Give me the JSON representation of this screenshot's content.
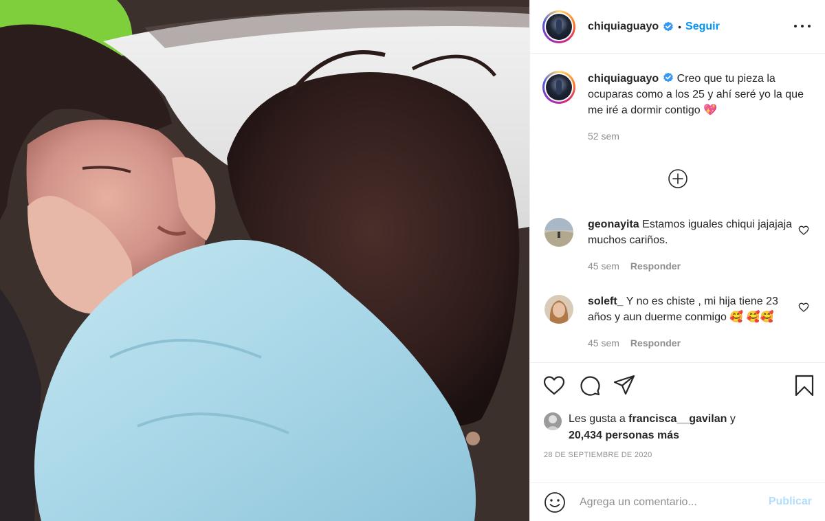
{
  "post": {
    "username": "chiquiaguayo",
    "follow_label": "Seguir",
    "dot": "•",
    "verified_icon": "verified-badge-icon",
    "more_icon": "more-options-icon"
  },
  "caption": {
    "username": "chiquiaguayo",
    "text": "Creo que tu pieza la ocuparas como a los 25 y ahí seré yo la que me iré a dormir contigo 💖",
    "time": "52 sem"
  },
  "load_more_icon": "plus-circle-icon",
  "comments": [
    {
      "username": "geonayita",
      "text": "Estamos iguales chiqui jajajaja muchos cariños.",
      "time": "45 sem",
      "reply_label": "Responder"
    },
    {
      "username": "soleft_",
      "text": "Y no es chiste , mi hija tiene 23 años y aun duerme conmigo 🥰 🥰🥰",
      "time": "45 sem",
      "reply_label": "Responder"
    }
  ],
  "actions": {
    "like_icon": "heart-icon",
    "comment_icon": "comment-icon",
    "share_icon": "paper-plane-icon",
    "save_icon": "bookmark-icon"
  },
  "likes": {
    "prefix": "Les gusta a ",
    "user": "francisca__gavilan",
    "suffix": " y",
    "count": "20,434 personas más"
  },
  "date": "28 DE SEPTIEMBRE DE 2020",
  "add_comment": {
    "placeholder": "Agrega un comentario...",
    "publish_label": "Publicar",
    "emoji_icon": "smiley-icon"
  },
  "colors": {
    "accent": "#0095f6",
    "publish_disabled": "#b2dffc",
    "muted": "#8e8e8e",
    "text": "#262626"
  }
}
